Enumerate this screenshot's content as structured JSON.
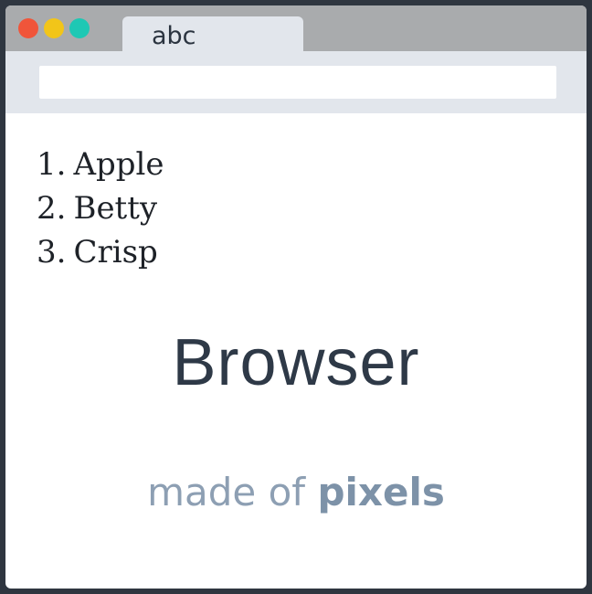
{
  "window": {
    "controls": [
      "close",
      "minimize",
      "maximize"
    ],
    "colors": {
      "close": "#f0553a",
      "minimize": "#f2c519",
      "maximize": "#1ec8b4"
    }
  },
  "tab": {
    "label": "abc"
  },
  "address_bar": {
    "value": ""
  },
  "list": {
    "items": [
      {
        "number": "1.",
        "text": "Apple"
      },
      {
        "number": "2.",
        "text": "Betty"
      },
      {
        "number": "3.",
        "text": "Crisp"
      }
    ]
  },
  "headline": "Browser",
  "subline": {
    "prefix": "made of",
    "emphasis": "pixels"
  }
}
